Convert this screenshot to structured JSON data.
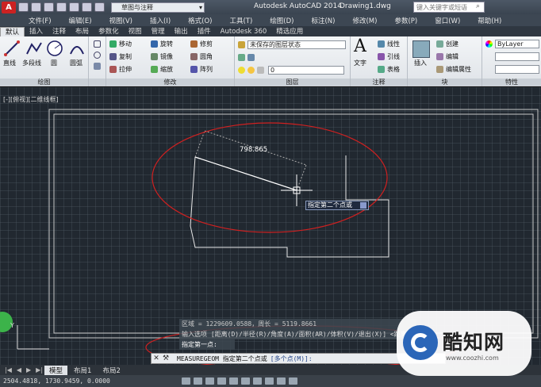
{
  "window": {
    "app_title": "Autodesk AutoCAD 2014",
    "doc_title": "Drawing1.dwg",
    "workspace": "草图与注释",
    "search_placeholder": "键入关键字或短语",
    "logo_letter": "A"
  },
  "menu": [
    "文件(F)",
    "编辑(E)",
    "视图(V)",
    "插入(I)",
    "格式(O)",
    "工具(T)",
    "绘图(D)",
    "标注(N)",
    "修改(M)",
    "参数(P)",
    "窗口(W)",
    "帮助(H)"
  ],
  "ribbon_tabs": [
    "默认",
    "插入",
    "注释",
    "布局",
    "参数化",
    "视图",
    "管理",
    "输出",
    "插件",
    "Autodesk 360",
    "精选应用"
  ],
  "ribbon": {
    "draw": {
      "title": "绘图",
      "tools": [
        "直线",
        "多段线",
        "圆",
        "圆弧"
      ]
    },
    "modify": {
      "title": "修改",
      "tools": [
        "移动",
        "旋转",
        "修剪",
        "复制",
        "镜像",
        "圆角",
        "拉伸",
        "缩放",
        "阵列"
      ]
    },
    "layers": {
      "title": "图层",
      "state": "未保存的图层状态",
      "current": "0"
    },
    "annotation": {
      "title": "注释",
      "big_tool": "文字",
      "tools": [
        "线性",
        "引线",
        "表格"
      ]
    },
    "block": {
      "title": "块",
      "big_tool": "插入",
      "tools": [
        "创建",
        "编辑",
        "编辑属性"
      ]
    },
    "properties": {
      "title": "特性",
      "layer": "ByLayer"
    }
  },
  "canvas": {
    "viewport_label": "[-][俯视][二维线框]",
    "dim_value": "798.865",
    "tooltip": "指定第二个点或",
    "command_history": [
      "区域 = 1229609.0588，周长 = 5119.8661",
      "输入选项 [距离(D)/半径(R)/角度(A)/面积(AR)/体积(V)/退出(X)] <距离>:",
      "指定第一点:"
    ],
    "command_prompt": "MEASUREGEOM 指定第二个点或",
    "command_option": "[多个点(M)]:",
    "ucs_y": "Y"
  },
  "layout_tabs": [
    "模型",
    "布局1",
    "布局2"
  ],
  "status": {
    "coords": "2504.4818, 1730.9459, 0.0000"
  },
  "watermark": {
    "text": "酷知网",
    "url": "www.coozhi.com"
  },
  "colors": {
    "ellipse": "#d02020",
    "geometry": "#e8e8e8",
    "canvas": "#212830"
  }
}
